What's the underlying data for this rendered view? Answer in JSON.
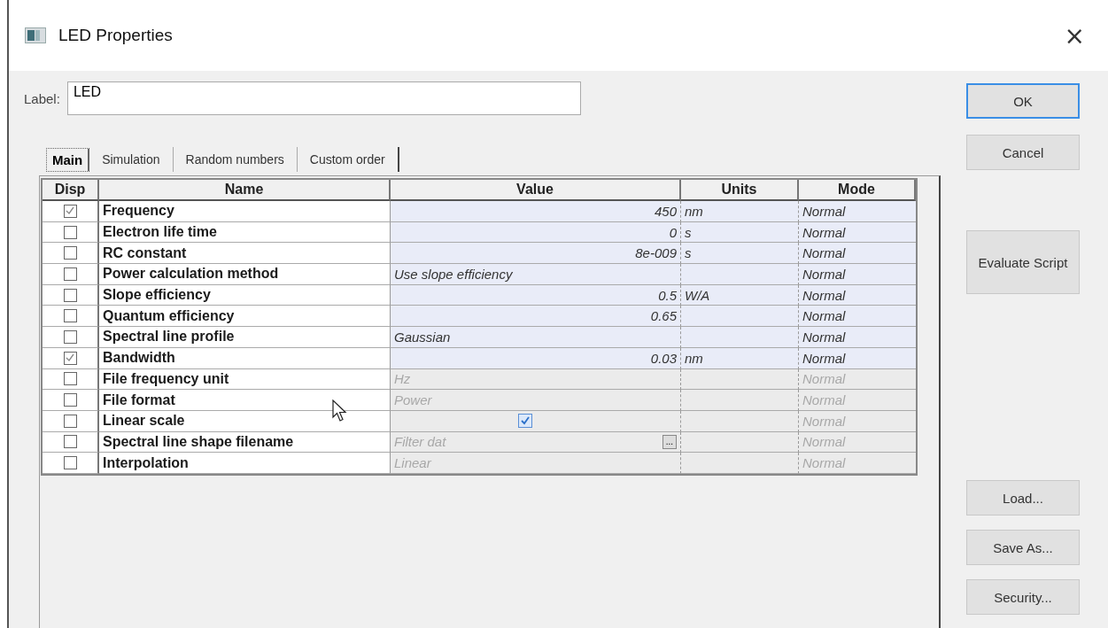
{
  "window": {
    "title": "LED Properties",
    "close": "×"
  },
  "label_field": {
    "label": "Label:",
    "value": "LED"
  },
  "tabs": [
    {
      "label": "Main",
      "selected": true
    },
    {
      "label": "Simulation",
      "selected": false
    },
    {
      "label": "Random numbers",
      "selected": false
    },
    {
      "label": "Custom order",
      "selected": false
    }
  ],
  "table": {
    "columns": [
      "Disp",
      "Name",
      "Value",
      "Units",
      "Mode"
    ],
    "rows": [
      {
        "disp": true,
        "name": "Frequency",
        "kind": "number",
        "value": "450",
        "units": "nm",
        "mode": "Normal",
        "disabled": false
      },
      {
        "disp": false,
        "name": "Electron life time",
        "kind": "number",
        "value": "0",
        "units": "s",
        "mode": "Normal",
        "disabled": false
      },
      {
        "disp": false,
        "name": "RC constant",
        "kind": "number",
        "value": "8e-009",
        "units": "s",
        "mode": "Normal",
        "disabled": false
      },
      {
        "disp": false,
        "name": "Power calculation method",
        "kind": "text",
        "value": "Use slope efficiency",
        "mode": "Normal",
        "disabled": false
      },
      {
        "disp": false,
        "name": "Slope efficiency",
        "kind": "number",
        "value": "0.5",
        "units": "W/A",
        "mode": "Normal",
        "disabled": false
      },
      {
        "disp": false,
        "name": "Quantum efficiency",
        "kind": "number",
        "value": "0.65",
        "mode": "Normal",
        "disabled": false
      },
      {
        "disp": false,
        "name": "Spectral line profile",
        "kind": "text",
        "value": "Gaussian",
        "mode": "Normal",
        "disabled": false
      },
      {
        "disp": true,
        "name": "Bandwidth",
        "kind": "number",
        "value": "0.03",
        "units": "nm",
        "mode": "Normal",
        "disabled": false
      },
      {
        "disp": false,
        "name": "File frequency unit",
        "kind": "text",
        "value": "Hz",
        "mode": "Normal",
        "disabled": true
      },
      {
        "disp": false,
        "name": "File format",
        "kind": "text",
        "value": "Power",
        "mode": "Normal",
        "disabled": true
      },
      {
        "disp": false,
        "name": "Linear scale",
        "kind": "checkbox",
        "checked": true,
        "mode": "Normal",
        "disabled": true
      },
      {
        "disp": false,
        "name": "Spectral line shape filename",
        "kind": "file",
        "value": "Filter dat",
        "button": "...",
        "mode": "Normal",
        "disabled": true
      },
      {
        "disp": false,
        "name": "Interpolation",
        "kind": "text",
        "value": "Linear",
        "mode": "Normal",
        "disabled": true
      }
    ]
  },
  "buttons": [
    {
      "label": "OK",
      "kind": "default"
    },
    {
      "label": "Cancel",
      "kind": "normal"
    },
    {
      "label": "Evaluate Script",
      "kind": "tall"
    },
    {
      "label": "Load...",
      "kind": "normal"
    },
    {
      "label": "Save As...",
      "kind": "normal"
    },
    {
      "label": "Security...",
      "kind": "normal"
    }
  ]
}
